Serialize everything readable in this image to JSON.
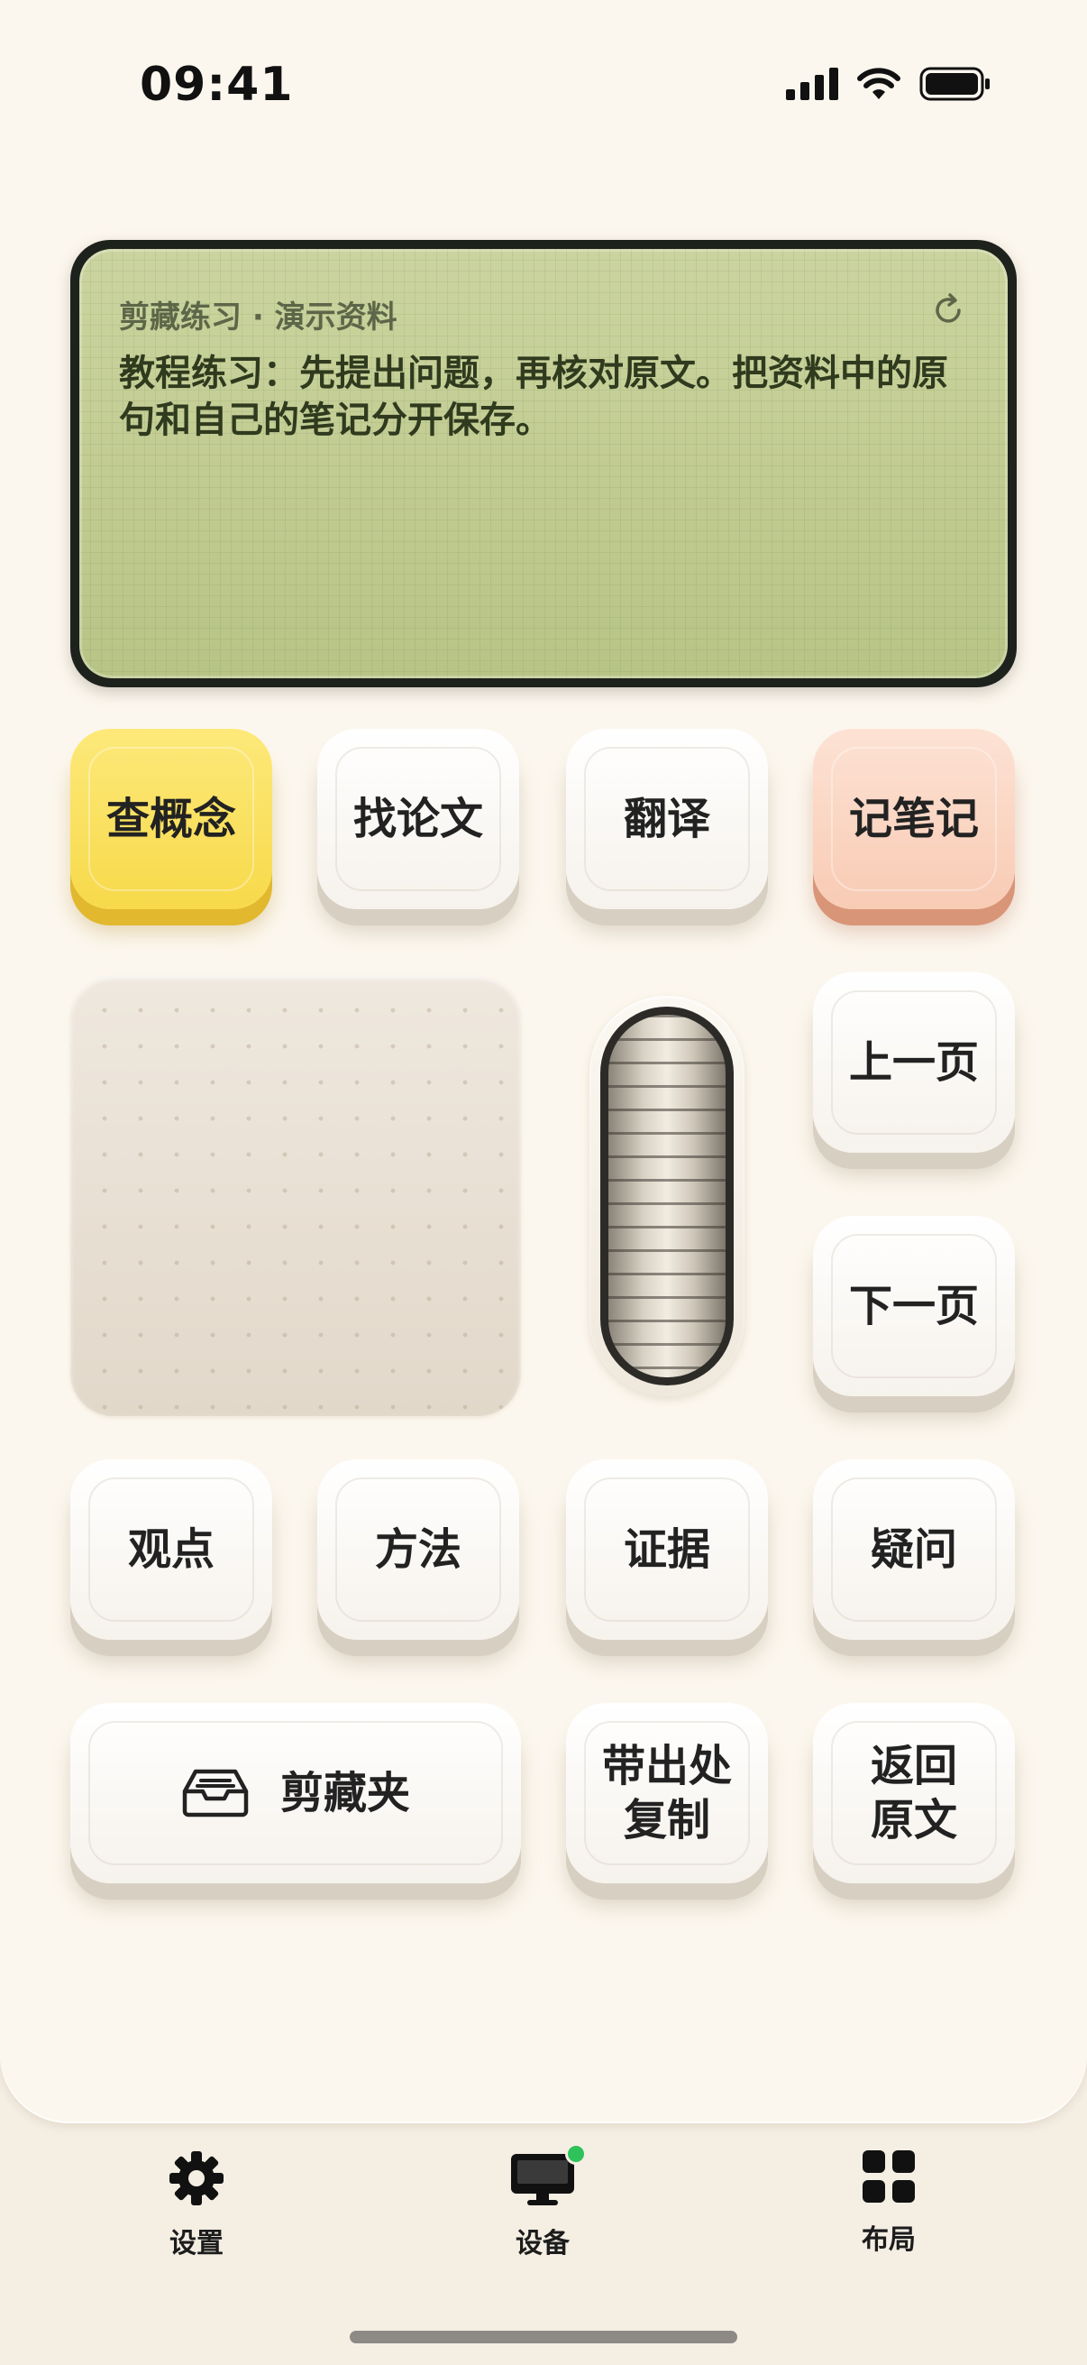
{
  "status_bar": {
    "time": "09:41",
    "icons": [
      "signal-icon",
      "wifi-icon",
      "battery-icon"
    ]
  },
  "display": {
    "title": "剪藏练习 · 演示资料",
    "text": "教程练习：先提出问题，再核对原文。把资料中的原句和自己的笔记分开保存。",
    "refresh_icon": "refresh-icon"
  },
  "keys": {
    "row1": [
      "查概念",
      "找论文",
      "翻译",
      "记笔记"
    ],
    "prev_page": "上一页",
    "next_page": "下一页",
    "row3": [
      "观点",
      "方法",
      "证据",
      "疑问"
    ],
    "clip_folder": "剪藏夹",
    "clip_folder_icon": "inbox-tray-icon",
    "copy_with_source": "带出处\n复制",
    "back_to_source": "返回\n原文"
  },
  "tabs": [
    {
      "label": "设置",
      "icon": "gear-icon"
    },
    {
      "label": "设备",
      "icon": "monitor-icon",
      "badge_color": "#2fc25b"
    },
    {
      "label": "布局",
      "icon": "grid-icon"
    }
  ],
  "colors": {
    "yellow_key": "#f7d94a",
    "peach_key": "#f8cbb4",
    "display": "#c4cd95"
  }
}
